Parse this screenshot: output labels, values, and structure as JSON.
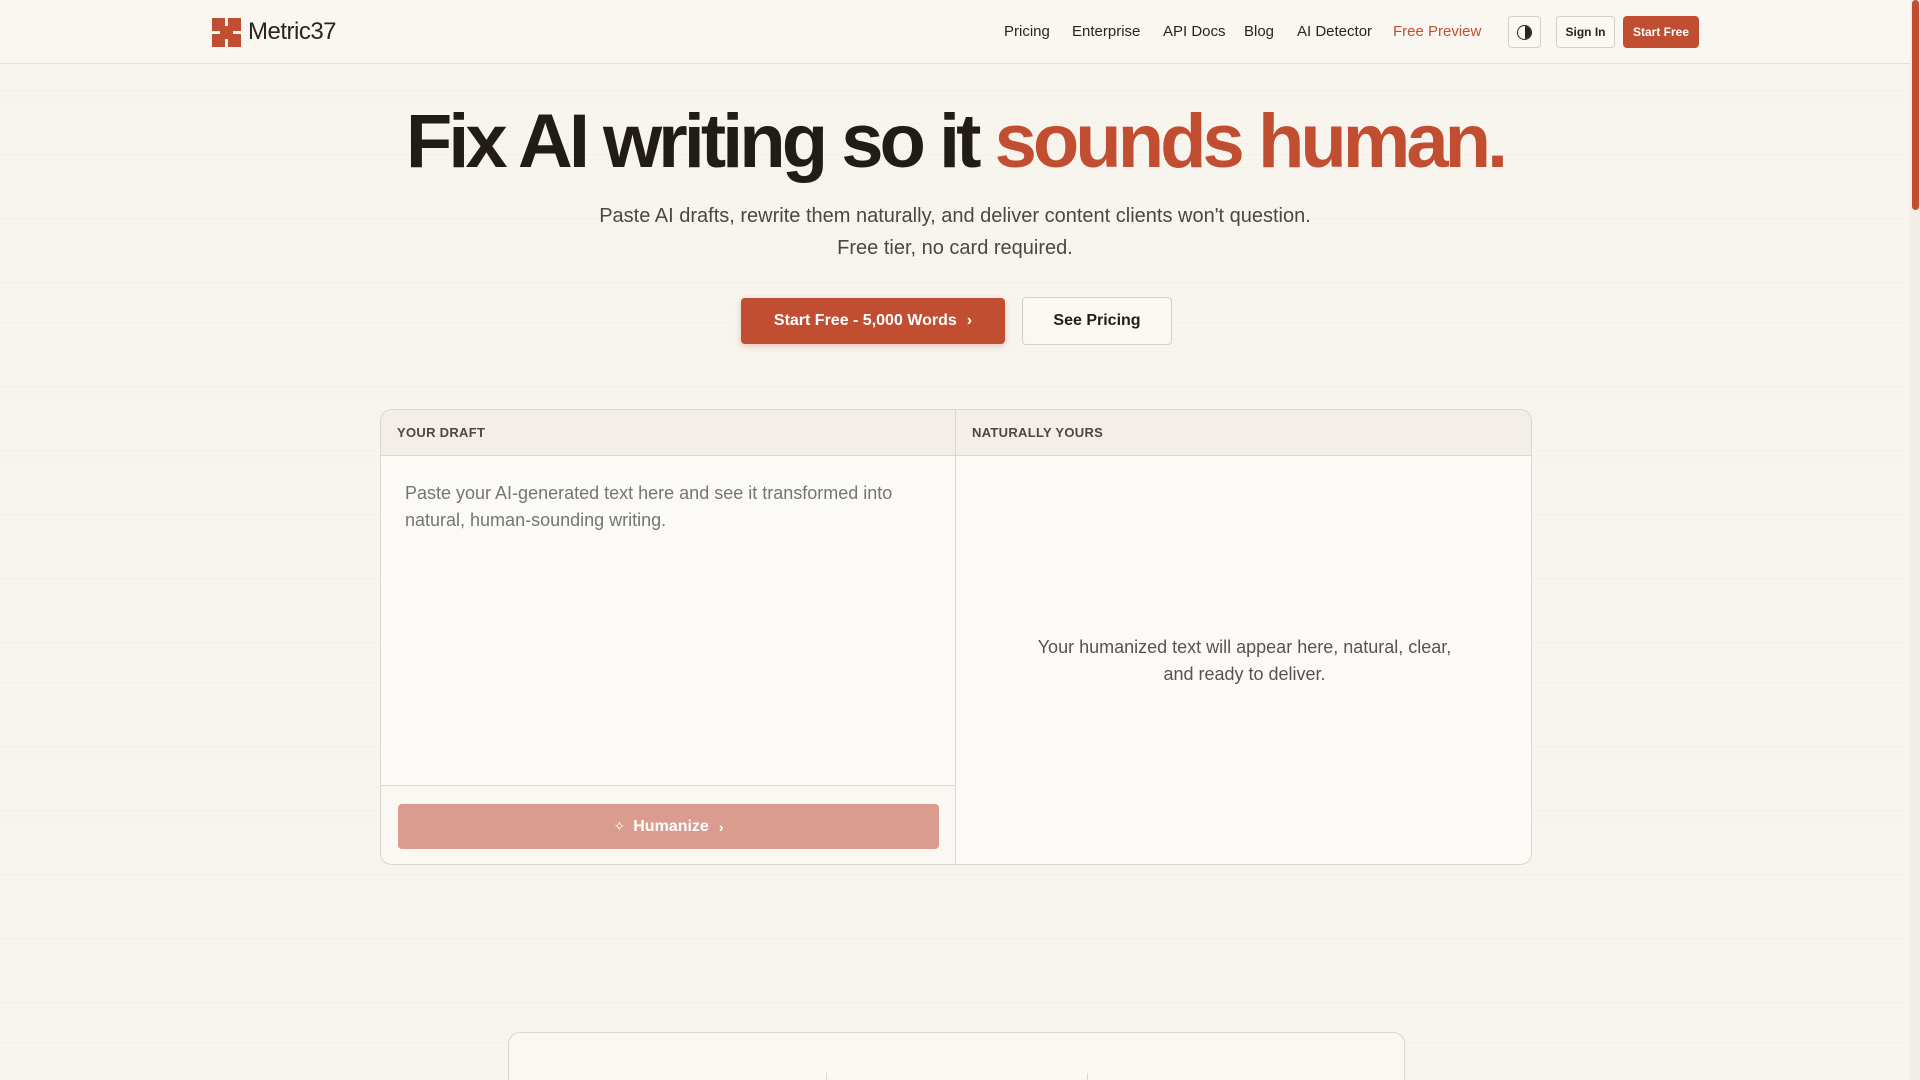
{
  "brand": {
    "name": "Metric37",
    "accent": "#c24e32"
  },
  "nav": {
    "links": [
      "Pricing",
      "Enterprise",
      "API Docs",
      "Blog",
      "AI Detector",
      "Free Preview"
    ],
    "theme_icon": "contrast-icon",
    "sign_in": "Sign In",
    "start_free": "Start Free"
  },
  "hero": {
    "title_main": "Fix AI writing so it ",
    "title_accent": "sounds human.",
    "subtitle_line1": "Paste AI drafts, rewrite them naturally, and deliver content clients won't question.",
    "subtitle_line2": "Free tier, no card required.",
    "cta_primary": "Start Free - 5,000 Words",
    "cta_secondary": "See Pricing"
  },
  "editor": {
    "left_header": "YOUR DRAFT",
    "right_header": "NATURALLY YOURS",
    "draft_placeholder": "Paste your AI-generated text here and see it transformed into natural, human-sounding writing.",
    "humanize_label": "Humanize",
    "output_placeholder": "Your humanized text will appear here, natural, clear, and ready to deliver."
  }
}
